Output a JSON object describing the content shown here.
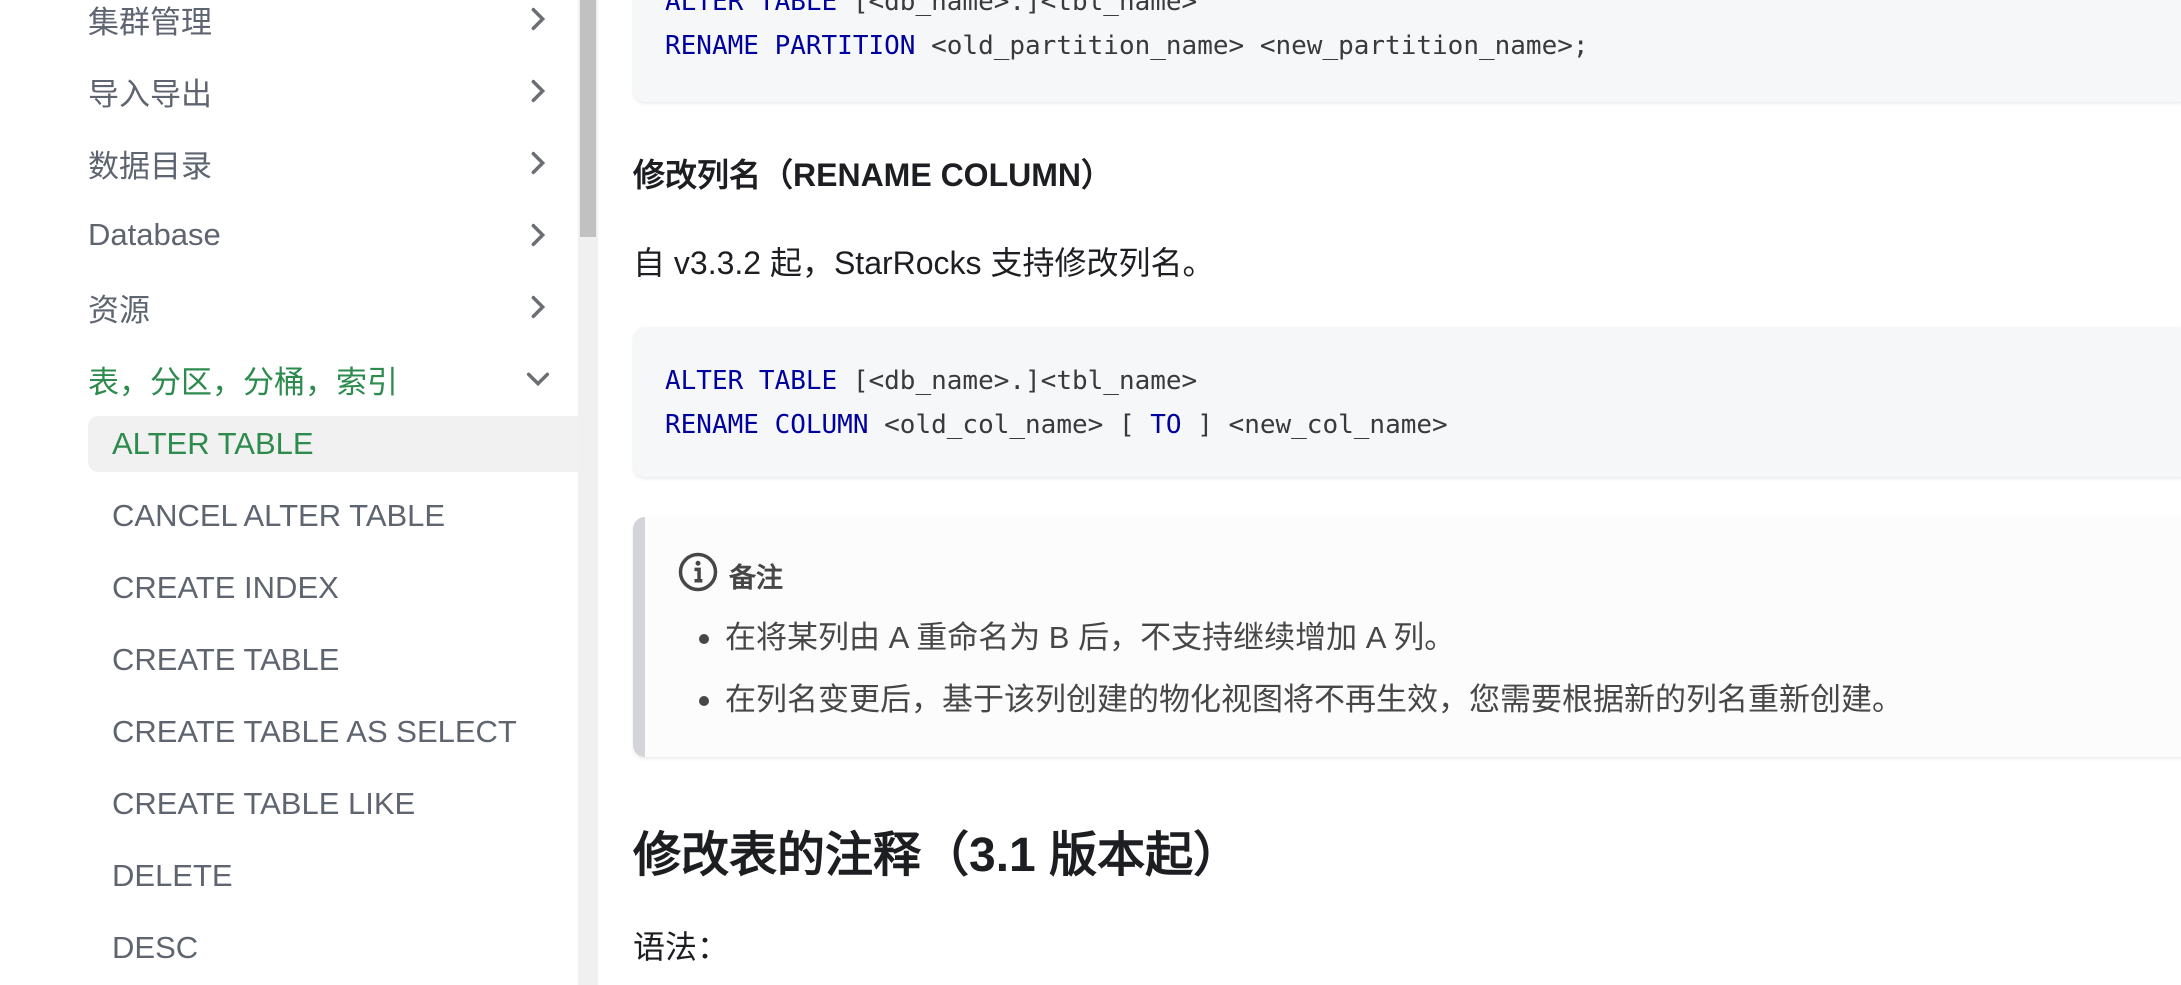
{
  "sidebar": {
    "categories": [
      {
        "label": "集群管理",
        "expanded": false
      },
      {
        "label": "导入导出",
        "expanded": false
      },
      {
        "label": "数据目录",
        "expanded": false
      },
      {
        "label": "Database",
        "expanded": false
      },
      {
        "label": "资源",
        "expanded": false
      },
      {
        "label": "表，分区，分桶，索引",
        "expanded": true
      }
    ],
    "sub_items": [
      {
        "label": "ALTER TABLE",
        "active": true
      },
      {
        "label": "CANCEL ALTER TABLE",
        "active": false
      },
      {
        "label": "CREATE INDEX",
        "active": false
      },
      {
        "label": "CREATE TABLE",
        "active": false
      },
      {
        "label": "CREATE TABLE AS SELECT",
        "active": false
      },
      {
        "label": "CREATE TABLE LIKE",
        "active": false
      },
      {
        "label": "DELETE",
        "active": false
      },
      {
        "label": "DESC",
        "active": false
      }
    ],
    "active_color": "#2e8b4e"
  },
  "content": {
    "code_top": {
      "line1": {
        "kw": "ALTER TABLE",
        "rest": " [<db_name>.]<tbl_name>"
      },
      "line2": {
        "kw": "RENAME PARTITION",
        "rest": " <old_partition_name> <new_partition_name>;"
      }
    },
    "rename_column_heading": "修改列名（RENAME COLUMN）",
    "rename_column_desc": "自 v3.3.2 起，StarRocks 支持修改列名。",
    "code_mid": {
      "line1": {
        "kw": "ALTER TABLE",
        "rest": " [<db_name>.]<tbl_name>"
      },
      "line2": {
        "kw": "RENAME COLUMN",
        "rest1": " <old_col_name> [ ",
        "kw2": "TO",
        "rest2": " ] <new_col_name>"
      }
    },
    "note": {
      "title": "备注",
      "icon": "info-icon",
      "items": [
        "在将某列由 A 重命名为 B 后，不支持继续增加 A 列。",
        "在列名变更后，基于该列创建的物化视图将不再生效，您需要根据新的列名重新创建。"
      ]
    },
    "comment_heading": "修改表的注释（3.1 版本起）",
    "syntax_label": "语法："
  }
}
